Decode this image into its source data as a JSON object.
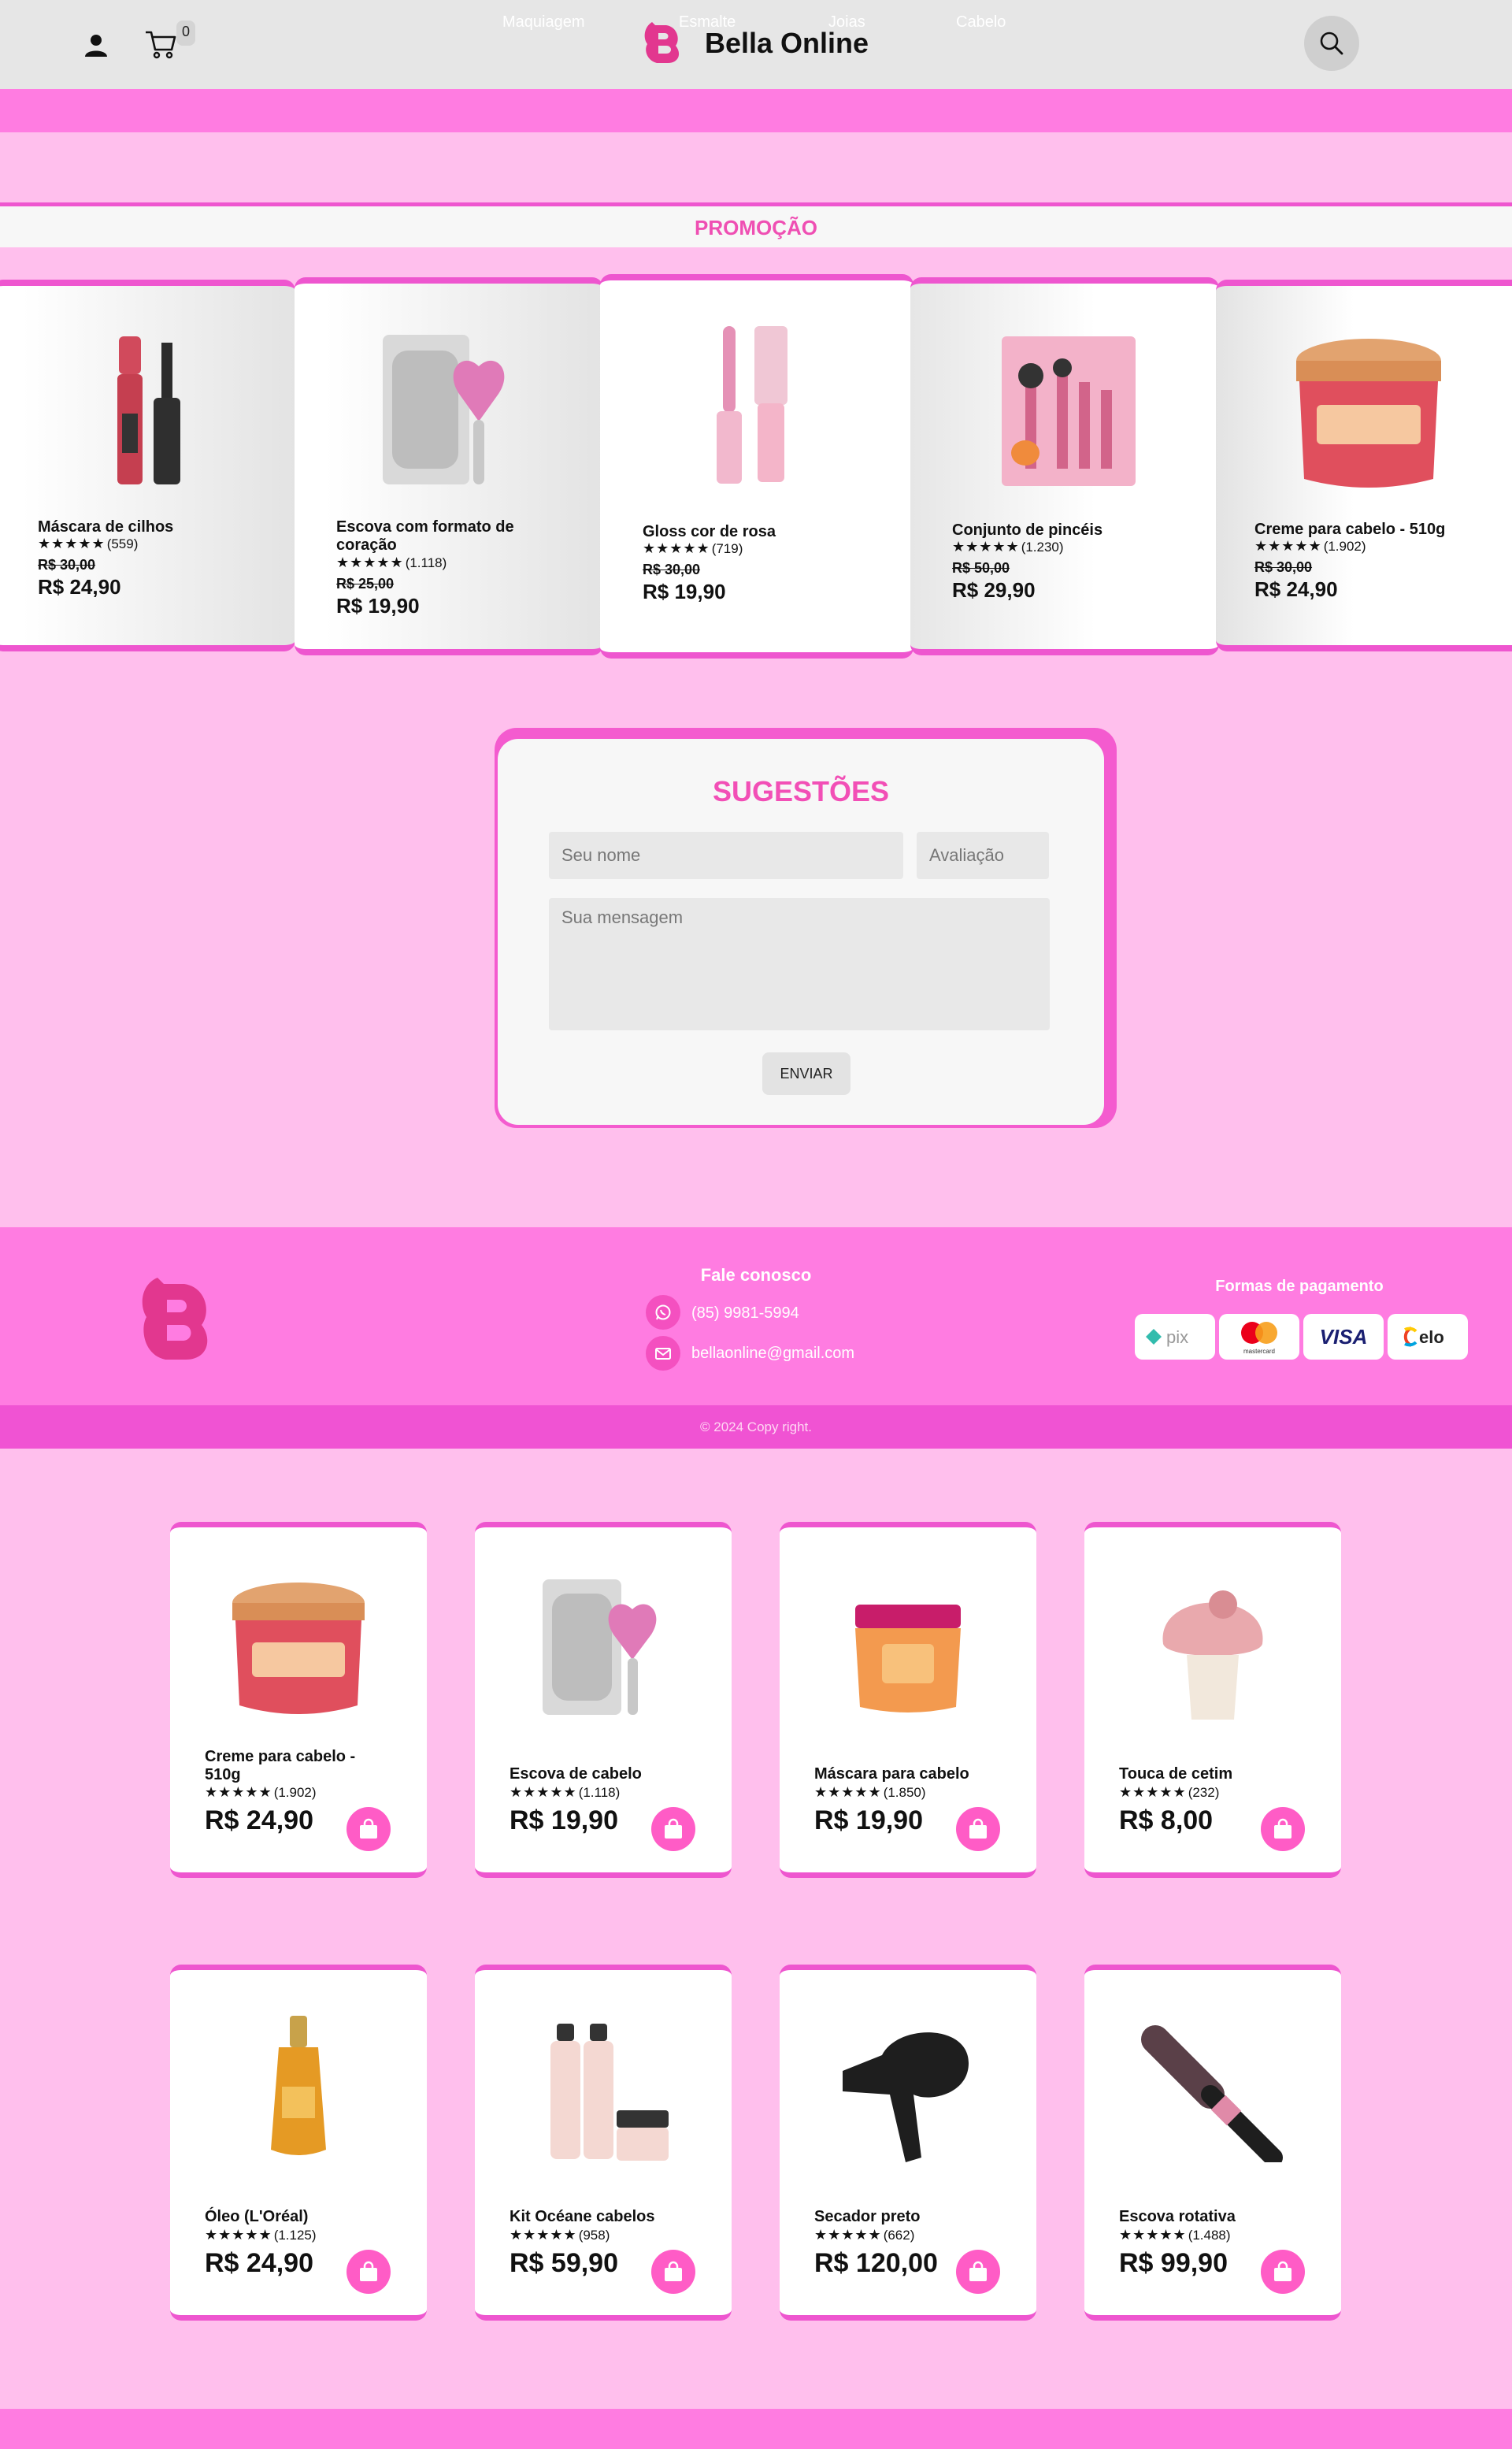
{
  "header": {
    "brand": "Bella Online",
    "cart_count": "0",
    "nav": [
      "Maquiagem",
      "Esmalte",
      "Joias",
      "Cabelo"
    ]
  },
  "promo": {
    "title": "PROMOÇÃO",
    "items": [
      {
        "name": "Máscara de cilhos",
        "stars": "★★★★★",
        "count": "(559)",
        "old_price": "R$ 30,00",
        "price": "R$ 24,90",
        "image": "mascara-icon"
      },
      {
        "name": "Escova com formato de coração",
        "stars": "★★★★★",
        "count": "(1.118)",
        "old_price": "R$ 25,00",
        "price": "R$ 19,90",
        "image": "heart-brush-icon"
      },
      {
        "name": "Gloss cor de rosa",
        "stars": "★★★★★",
        "count": "(719)",
        "old_price": "R$ 30,00",
        "price": "R$ 19,90",
        "image": "gloss-icon"
      },
      {
        "name": "Conjunto de pincéis",
        "stars": "★★★★★",
        "count": "(1.230)",
        "old_price": "R$ 50,00",
        "price": "R$ 29,90",
        "image": "brush-set-icon"
      },
      {
        "name": "Creme para cabelo - 510g",
        "stars": "★★★★★",
        "count": "(1.902)",
        "old_price": "R$ 30,00",
        "price": "R$ 24,90",
        "image": "jar-icon"
      }
    ]
  },
  "form": {
    "title": "SUGESTÕES",
    "name_placeholder": "Seu nome",
    "rating_placeholder": "Avaliação",
    "message_placeholder": "Sua mensagem",
    "send": "ENVIAR"
  },
  "footer": {
    "contact_title": "Fale conosco",
    "phone": "(85) 9981-5994",
    "email": "bellaonline@gmail.com",
    "payment_title": "Formas de pagamento",
    "payments": [
      "pix",
      "mastercard",
      "VISA",
      "elo"
    ],
    "copyright": "© 2024 Copy right."
  },
  "products": [
    {
      "name": "Creme para cabelo - 510g",
      "stars": "★★★★★",
      "count": "(1.902)",
      "price": "R$ 24,90",
      "image": "jar-icon"
    },
    {
      "name": "Escova de cabelo",
      "stars": "★★★★★",
      "count": "(1.118)",
      "price": "R$ 19,90",
      "image": "heart-brush-icon"
    },
    {
      "name": "Máscara para cabelo",
      "stars": "★★★★★",
      "count": "(1.850)",
      "price": "R$ 19,90",
      "image": "hair-mask-icon"
    },
    {
      "name": "Touca de cetim",
      "stars": "★★★★★",
      "count": "(232)",
      "price": "R$ 8,00",
      "image": "satin-cap-icon"
    },
    {
      "name": "Óleo (L'Oréal)",
      "stars": "★★★★★",
      "count": "(1.125)",
      "price": "R$ 24,90",
      "image": "oil-bottle-icon"
    },
    {
      "name": "Kit Océane cabelos",
      "stars": "★★★★★",
      "count": "(958)",
      "price": "R$ 59,90",
      "image": "hair-kit-icon"
    },
    {
      "name": "Secador preto",
      "stars": "★★★★★",
      "count": "(662)",
      "price": "R$ 120,00",
      "image": "hair-dryer-icon"
    },
    {
      "name": "Escova rotativa",
      "stars": "★★★★★",
      "count": "(1.488)",
      "price": "R$ 99,90",
      "image": "rotating-brush-icon"
    }
  ],
  "colors": {
    "pink_dark": "#ee56cf",
    "pink_nav": "#ff7ce1",
    "pink_bg": "#ffbfed",
    "promo_title": "#ef4fb3"
  }
}
